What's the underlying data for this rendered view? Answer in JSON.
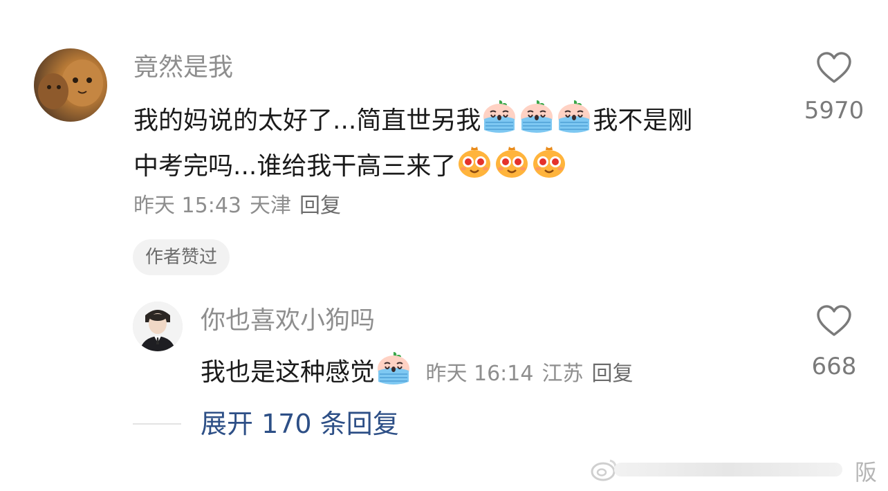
{
  "comment": {
    "username": "竟然是我",
    "text_line1_a": "我的妈说的太好了...简直世另我",
    "text_line1_b": "我不是刚",
    "text_line2": "中考完吗...谁给我干高三来了",
    "time": "昨天 15:43",
    "location": "天津",
    "reply_label": "回复",
    "badge": "作者赞过",
    "like_count": "5970",
    "emojis_line1": [
      "crying-emoji",
      "crying-emoji",
      "crying-emoji"
    ],
    "emojis_line2": [
      "starstruck-emoji",
      "starstruck-emoji",
      "starstruck-emoji"
    ]
  },
  "reply": {
    "username": "你也喜欢小狗吗",
    "text": "我也是这种感觉",
    "time": "昨天 16:14",
    "location": "江苏",
    "reply_label": "回复",
    "like_count": "668",
    "emojis": [
      "crying-emoji"
    ]
  },
  "expand": {
    "label": "展开 170 条回复"
  },
  "watermark": {
    "char": "阪"
  },
  "colors": {
    "username": "#8e8e8e",
    "link": "#2d4f86",
    "text": "#1a1a1a"
  }
}
